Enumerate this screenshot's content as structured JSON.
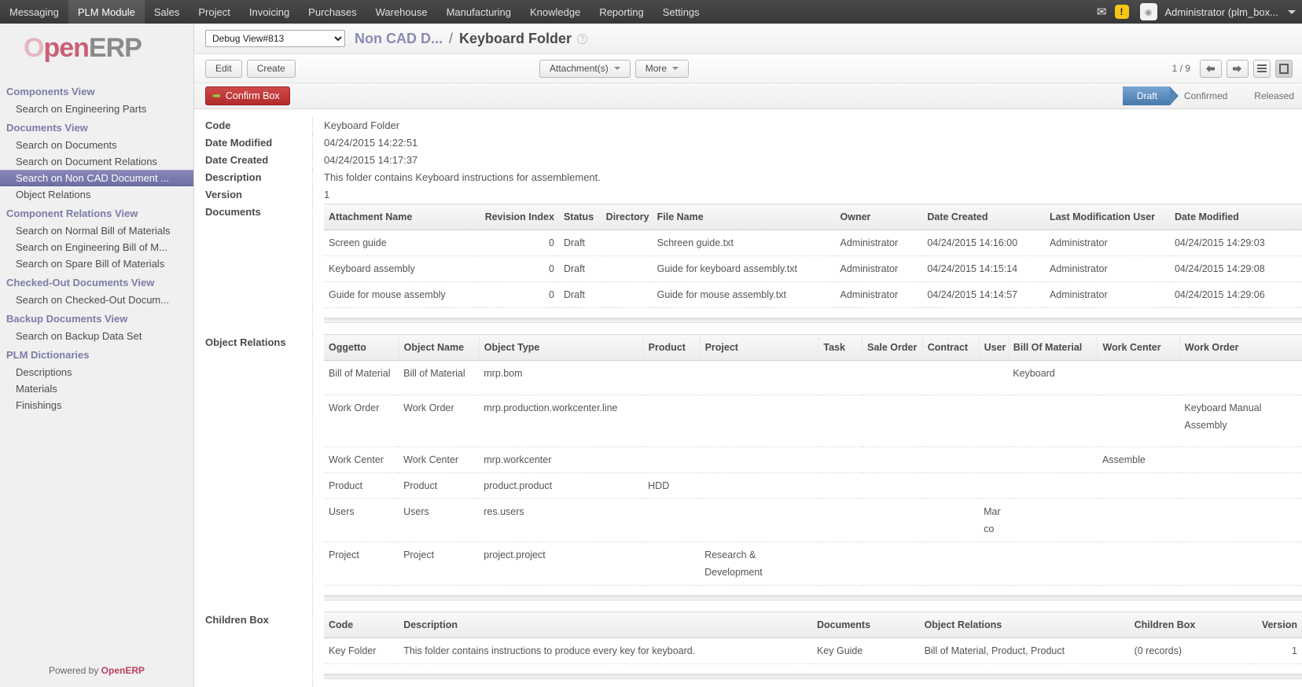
{
  "topbar": {
    "menu": [
      {
        "label": "Messaging",
        "active": false
      },
      {
        "label": "PLM Module",
        "active": true
      },
      {
        "label": "Sales",
        "active": false
      },
      {
        "label": "Project",
        "active": false
      },
      {
        "label": "Invoicing",
        "active": false
      },
      {
        "label": "Purchases",
        "active": false
      },
      {
        "label": "Warehouse",
        "active": false
      },
      {
        "label": "Manufacturing",
        "active": false
      },
      {
        "label": "Knowledge",
        "active": false
      },
      {
        "label": "Reporting",
        "active": false
      },
      {
        "label": "Settings",
        "active": false
      }
    ],
    "mail_icon": "envelope-icon",
    "warning_icon": "warning-badge-icon",
    "warning_glyph": "!",
    "avatar_icon": "avatar-icon",
    "user": "Administrator (plm_box...",
    "caret": "chevron-down-icon"
  },
  "sidebar": {
    "logo": {
      "part1": "O",
      "part2": "pen",
      "part3": "ERP"
    },
    "groups": [
      {
        "title": "Components View",
        "items": [
          {
            "label": "Search on Engineering Parts",
            "selected": false
          }
        ]
      },
      {
        "title": "Documents View",
        "items": [
          {
            "label": "Search on Documents",
            "selected": false
          },
          {
            "label": "Search on Document Relations",
            "selected": false
          },
          {
            "label": "Search on Non CAD Document ...",
            "selected": true
          },
          {
            "label": "Object Relations",
            "selected": false
          }
        ]
      },
      {
        "title": "Component Relations View",
        "items": [
          {
            "label": "Search on Normal Bill of Materials",
            "selected": false
          },
          {
            "label": "Search on Engineering Bill of M...",
            "selected": false
          },
          {
            "label": "Search on Spare Bill of Materials",
            "selected": false
          }
        ]
      },
      {
        "title": "Checked-Out Documents View",
        "items": [
          {
            "label": "Search on Checked-Out Docum...",
            "selected": false
          }
        ]
      },
      {
        "title": "Backup Documents View",
        "items": [
          {
            "label": "Search on Backup Data Set",
            "selected": false
          }
        ]
      },
      {
        "title": "PLM Dictionaries",
        "items": [
          {
            "label": "Descriptions",
            "selected": false
          },
          {
            "label": "Materials",
            "selected": false
          },
          {
            "label": "Finishings",
            "selected": false
          }
        ]
      }
    ],
    "footer_prefix": "Powered by ",
    "footer_brand": "OpenERP"
  },
  "breadcrumb": {
    "debug_view_selected": "Debug View#813",
    "debug_view_options": [
      "Debug View#813"
    ],
    "parent": "Non CAD D...",
    "separator": "/",
    "current": "Keyboard Folder",
    "help_glyph": "?"
  },
  "toolbar": {
    "edit_label": "Edit",
    "create_label": "Create",
    "attachments_label": "Attachment(s)",
    "more_label": "More",
    "pager": "1 / 9",
    "prev_glyph": "⬅",
    "next_glyph": "➡",
    "list_view_icon": "list-view-icon",
    "form_view_icon": "form-view-icon"
  },
  "statusbar": {
    "confirm_label": "Confirm Box",
    "confirm_glyph": "➡",
    "states": [
      {
        "label": "Draft",
        "active": true
      },
      {
        "label": "Confirmed",
        "active": false
      },
      {
        "label": "Released",
        "active": false
      }
    ]
  },
  "form": {
    "fields": [
      {
        "label": "Code",
        "value": "Keyboard Folder"
      },
      {
        "label": "Date Modified",
        "value": "04/24/2015 14:22:51"
      },
      {
        "label": "Date Created",
        "value": "04/24/2015 14:17:37"
      },
      {
        "label": "Description",
        "value": "This folder contains Keyboard instructions for assemblement."
      },
      {
        "label": "Version",
        "value": "1"
      }
    ],
    "documents_label": "Documents",
    "object_relations_label": "Object Relations",
    "children_box_label": "Children Box"
  },
  "documents_table": {
    "columns": [
      "Attachment Name",
      "Revision Index",
      "Status",
      "Directory",
      "File Name",
      "Owner",
      "Date Created",
      "Last Modification User",
      "Date Modified"
    ],
    "rows": [
      {
        "attachment_name": "Screen guide",
        "revision_index": "0",
        "status": "Draft",
        "directory": "",
        "file_name": "Schreen guide.txt",
        "owner": "Administrator",
        "date_created": "04/24/2015 14:16:00",
        "last_modification_user": "Administrator",
        "date_modified": "04/24/2015 14:29:03"
      },
      {
        "attachment_name": "Keyboard assembly",
        "revision_index": "0",
        "status": "Draft",
        "directory": "",
        "file_name": "Guide for keyboard assembly.txt",
        "owner": "Administrator",
        "date_created": "04/24/2015 14:15:14",
        "last_modification_user": "Administrator",
        "date_modified": "04/24/2015 14:29:08"
      },
      {
        "attachment_name": "Guide for mouse assembly",
        "revision_index": "0",
        "status": "Draft",
        "directory": "",
        "file_name": "Guide for mouse assembly.txt",
        "owner": "Administrator",
        "date_created": "04/24/2015 14:14:57",
        "last_modification_user": "Administrator",
        "date_modified": "04/24/2015 14:29:06"
      }
    ]
  },
  "object_relations_table": {
    "columns": [
      "Oggetto",
      "Object Name",
      "Object Type",
      "Product",
      "Project",
      "Task",
      "Sale Order",
      "Contract",
      "User",
      "Bill Of Material",
      "Work Center",
      "Work Order"
    ],
    "rows": [
      {
        "oggetto": "Bill of Material",
        "object_name": "Bill of Material",
        "object_type": "mrp.bom",
        "product": "",
        "project": "",
        "task": "",
        "sale_order": "",
        "contract": "",
        "user": "",
        "bill_of_material": "Keyboard",
        "work_center": "",
        "work_order": ""
      },
      {
        "oggetto": "Work Order",
        "object_name": "Work Order",
        "object_type": "mrp.production.workcenter.line",
        "product": "",
        "project": "",
        "task": "",
        "sale_order": "",
        "contract": "",
        "user": "",
        "bill_of_material": "",
        "work_center": "",
        "work_order": "Keyboard Manual Assembly"
      },
      {
        "oggetto": "Work Center",
        "object_name": "Work Center",
        "object_type": "mrp.workcenter",
        "product": "",
        "project": "",
        "task": "",
        "sale_order": "",
        "contract": "",
        "user": "",
        "bill_of_material": "",
        "work_center": "Assemble",
        "work_order": ""
      },
      {
        "oggetto": "Product",
        "object_name": "Product",
        "object_type": "product.product",
        "product": "HDD",
        "project": "",
        "task": "",
        "sale_order": "",
        "contract": "",
        "user": "",
        "bill_of_material": "",
        "work_center": "",
        "work_order": ""
      },
      {
        "oggetto": "Users",
        "object_name": "Users",
        "object_type": "res.users",
        "product": "",
        "project": "",
        "task": "",
        "sale_order": "",
        "contract": "",
        "user": "Marco",
        "bill_of_material": "",
        "work_center": "",
        "work_order": ""
      },
      {
        "oggetto": "Project",
        "object_name": "Project",
        "object_type": "project.project",
        "product": "",
        "project": "Research & Development",
        "task": "",
        "sale_order": "",
        "contract": "",
        "user": "",
        "bill_of_material": "",
        "work_center": "",
        "work_order": ""
      }
    ]
  },
  "children_box_table": {
    "columns": [
      "Code",
      "Description",
      "Documents",
      "Object Relations",
      "Children Box",
      "Version"
    ],
    "rows": [
      {
        "code": "Key Folder",
        "description": "This folder contains instructions to produce every key for keyboard.",
        "documents": "Key Guide",
        "object_relations": "Bill of Material, Product, Product",
        "children_box": "(0 records)",
        "version": "1"
      }
    ]
  },
  "colors": {
    "accent_purple": "#7b7bb0",
    "brand_red": "#b8415f",
    "confirm_red": "#c33b3b",
    "state_blue": "#5b87b8",
    "warning_yellow": "#f5c518"
  }
}
